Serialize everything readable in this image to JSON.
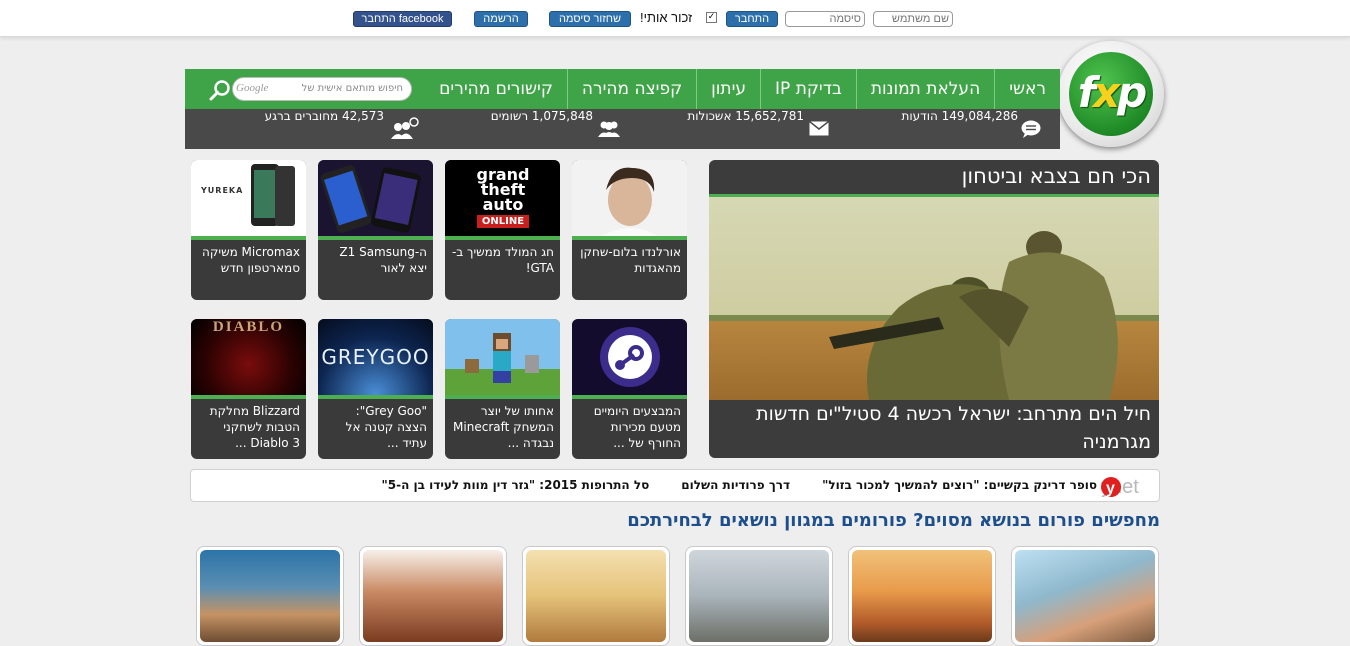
{
  "login": {
    "username_placeholder": "שם משתמש",
    "password_placeholder": "סיסמה",
    "login_button": "התחבר",
    "remember_me": "זכור אותי!",
    "forgot_password": "שחזור סיסמה",
    "register": "הרשמה",
    "facebook_login": "התחבר facebook"
  },
  "logo": {
    "text_f": "f",
    "text_x": "x",
    "text_p": "p"
  },
  "nav": {
    "items": [
      "ראשי",
      "העלאת תמונות",
      "בדיקת IP",
      "עיתון",
      "קפיצה מהירה",
      "קישורים מהירים"
    ],
    "search_placeholder": "חיפוש מותאם אישית של",
    "search_brand": "Google"
  },
  "stats": {
    "messages": "149,084,286 הודעות",
    "threads": "15,652,781 אשכולות",
    "members": "1,075,848 רשומים",
    "online": "42,573 מחוברים ברגע"
  },
  "feature": {
    "title": "הכי חם בצבא וביטחון",
    "caption": "חיל הים מתרחב: ישראל רכשה 4 סטיל\"ים חדשות מגרמניה"
  },
  "cards": [
    {
      "text": "אורלנדו בלום-שחקן מהאגדות"
    },
    {
      "text": "חג המולד ממשיך ב-GTA!"
    },
    {
      "text": "ה-Z1 Samsung יצא לאור"
    },
    {
      "text": "Micromax משיקה סמארטפון חדש"
    },
    {
      "text": "המבצעים היומיים מטעם מכירות החורף של ..."
    },
    {
      "text": "אחותו של יוצר המשחק Minecraft נבגדה ..."
    },
    {
      "text": "\"Grey Goo\": הצצה קטנה אל עתיד ..."
    },
    {
      "text": "Blizzard מחלקת הטבות לשחקני Diablo 3 ..."
    }
  ],
  "thumbs": {
    "gta_line1": "grand",
    "gta_line2": "theft",
    "gta_line3": "auto",
    "gta_online": "ONLINE",
    "greygoo": "GREYGOO",
    "diablo": "DIABLO",
    "yureka": "YUREKA"
  },
  "ticker": {
    "brand": "ynet",
    "items": [
      "סופר דרינק בקשיים: \"רוצים להמשיך למכור בזול\"",
      "דרך פרודיות השלום",
      "סל התרופות 2015: \"גזר דין מוות לעידו בן ה-5\""
    ]
  },
  "magazine": {
    "title": "מחפשים פורום בנושא מסוים? פורומים במגוון נושאים לבחירתכם"
  },
  "colors": {
    "nav_green": "#3fa447",
    "stats_dark": "#494949",
    "accent_blue": "#2d6faa",
    "title_blue": "#1d4f8c"
  }
}
